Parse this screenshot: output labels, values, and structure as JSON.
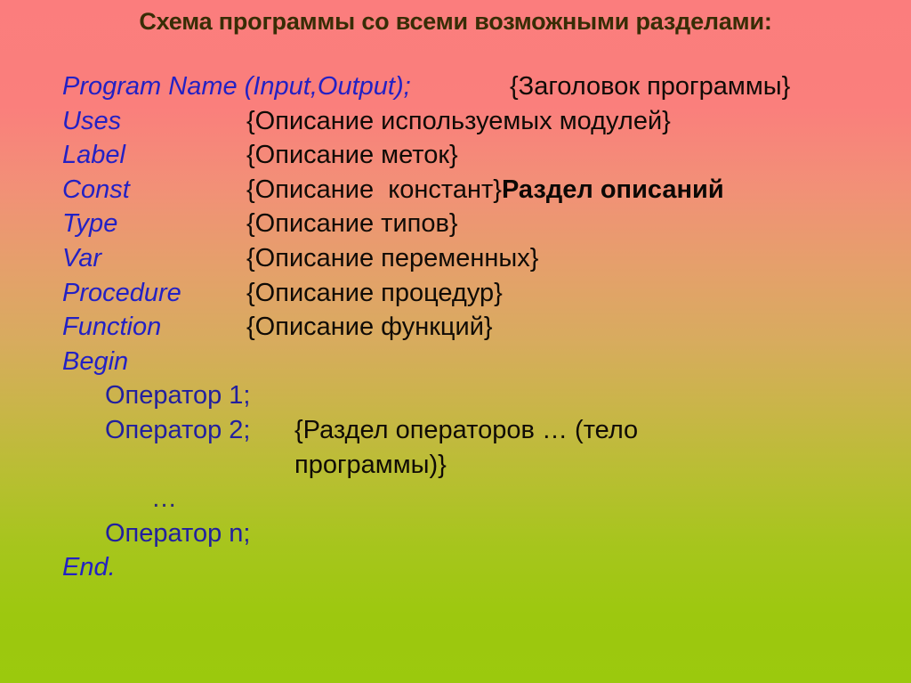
{
  "slide": {
    "title": "Схема программы со всеми возможными разделами:",
    "title_color": "#382d06",
    "keyword_color": "#2321c4",
    "description_color": "#100b06",
    "background_top_color": "#fb7d7d",
    "background_bottom_color": "#9bc90d"
  },
  "code": {
    "lines": [
      {
        "keyword": "Program Name (Input,Output);",
        "description": "{Заголовок программы}"
      },
      {
        "keyword": "Uses",
        "description": "{Описание используемых модулей}"
      },
      {
        "keyword": "Label",
        "description": "{Описание меток}"
      },
      {
        "keyword": "Const",
        "description": "{Описание  констант}",
        "note": "Раздел описаний"
      },
      {
        "keyword": "Type",
        "description": "{Описание типов}"
      },
      {
        "keyword": "Var",
        "description": "{Описание переменных}"
      },
      {
        "keyword": "Procedure",
        "description": "{Описание процедур}"
      },
      {
        "keyword": "Function",
        "description": "{Описание функций}"
      },
      {
        "keyword": "Begin",
        "description": ""
      },
      {
        "operator": "Оператор 1;"
      },
      {
        "operator": "Оператор 2;",
        "description": "{Раздел операторов … (тело"
      },
      {
        "continuation": "программы)}"
      },
      {
        "ellipsis": "…"
      },
      {
        "operator": "Оператор n;"
      },
      {
        "keyword": "End."
      }
    ]
  }
}
